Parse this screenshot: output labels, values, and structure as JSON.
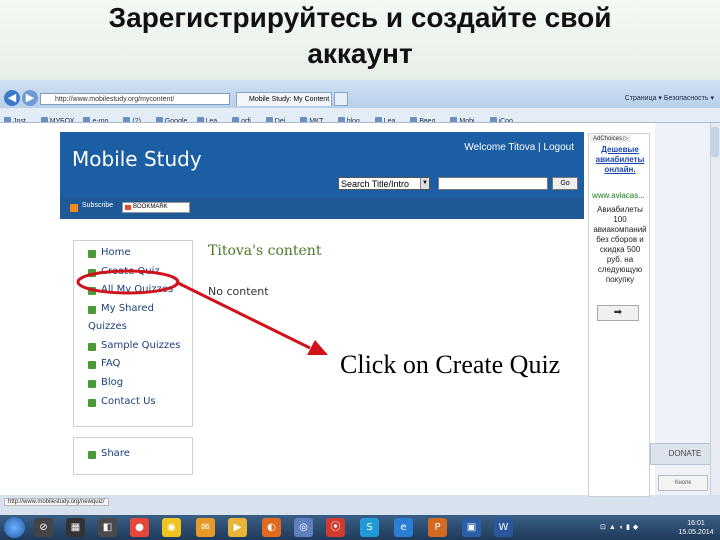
{
  "slide": {
    "title_line1": "Зарегистрируйтесь и создайте свой",
    "title_line2": "аккаунт"
  },
  "browser": {
    "address": "http://www.mobilestudy.org/mycontent/",
    "tab_title": "Mobile Study: My Content",
    "command_bar": "Страница ▾  Безопасность ▾",
    "favorites": [
      "Jnst...",
      "МУБОХ",
      "e-mo...",
      "(2)...",
      "Google",
      "Lea...",
      "orfi...",
      "Dei...",
      "МКТ...",
      "blog...",
      "Lea...",
      "Введ...",
      "Mobi...",
      "iCoo..."
    ]
  },
  "site": {
    "logo": "Mobile Study",
    "welcome": "Welcome Titova | Logout",
    "search_select": "Search Title/Intro",
    "go_button": "Go",
    "subscribe": "Subscribe",
    "bookmark": "BOOKMARK",
    "nav": {
      "home": "Home",
      "create_quiz": "Create Quiz",
      "all_my_quizzes": "All My Quizzes",
      "my_shared": "My Shared",
      "quizzes": "Quizzes",
      "sample_quizzes": "Sample Quizzes",
      "faq": "FAQ",
      "blog": "Blog",
      "contact_us": "Contact Us",
      "share": "Share"
    },
    "content_title": "Titova's content",
    "no_content": "No content"
  },
  "ad": {
    "choices": "AdChoices ▷",
    "headline": "Дешевые авиабилеты онлайн.",
    "url": "www.aviacas...",
    "text": "Авиабилеты 100 авиакомпаний без сборов и скидка 500 руб. на следующую покупку",
    "button": "➡"
  },
  "right_panel": {
    "donate": "DONATE",
    "button": "Кнопк"
  },
  "status_url": "http://www.mobilestudy.org/newquiz/",
  "callout": "Click on Create Quiz",
  "taskbar": {
    "time": "16:01",
    "date": "15.05.2014"
  },
  "colors": {
    "header_blue": "#1b5ea4",
    "annotation_red": "#d0121b",
    "content_green": "#4a7a26"
  }
}
